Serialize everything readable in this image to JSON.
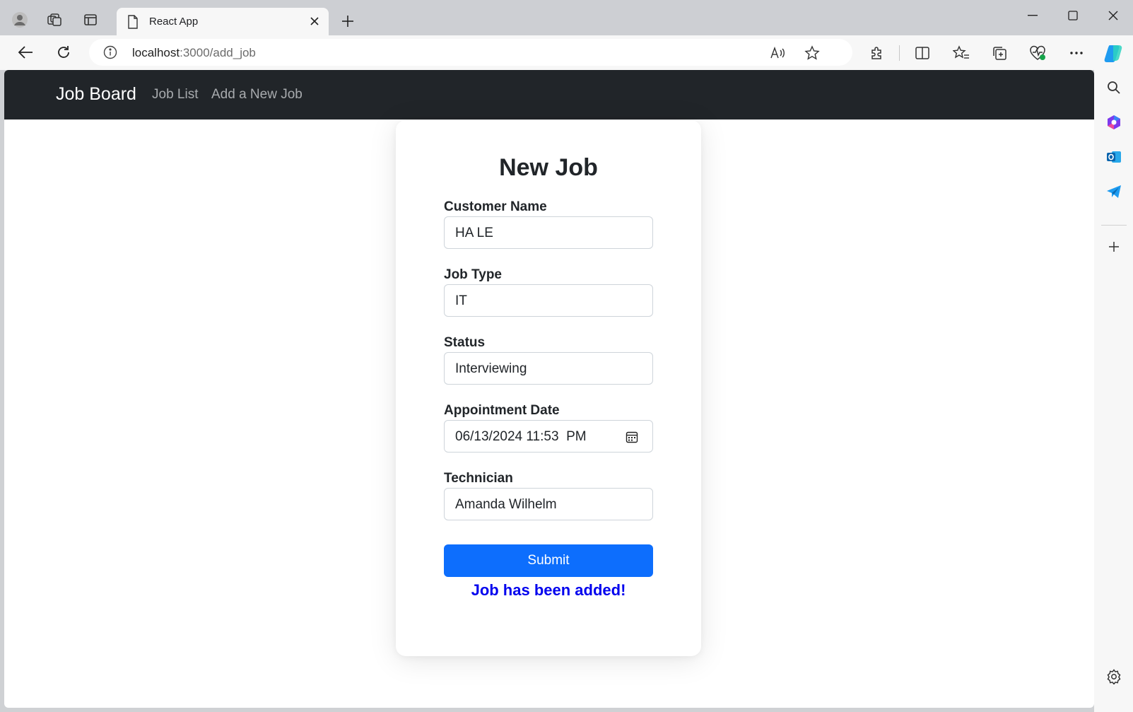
{
  "browser": {
    "tab_title": "React App",
    "address_host": "localhost",
    "address_path": ":3000/add_job"
  },
  "app": {
    "brand": "Job Board",
    "nav_links": [
      "Job List",
      "Add a New Job"
    ]
  },
  "form": {
    "title": "New Job",
    "fields": [
      {
        "label": "Customer Name",
        "value": "HA LE"
      },
      {
        "label": "Job Type",
        "value": "IT"
      },
      {
        "label": "Status",
        "value": "Interviewing"
      },
      {
        "label": "Appointment Date",
        "value": "06/13/2024 11:53  PM"
      },
      {
        "label": "Technician",
        "value": "Amanda Wilhelm"
      }
    ],
    "submit_label": "Submit",
    "success_message": "Job has been added!"
  },
  "colors": {
    "navbar_bg": "#212529",
    "primary": "#0d6efd",
    "success_text": "#0000ee"
  },
  "icons": {
    "tabbar": [
      "profile-icon",
      "workspaces-icon",
      "tab-actions-icon",
      "document-icon",
      "close-icon",
      "new-tab-icon"
    ],
    "toolbar": [
      "back-icon",
      "refresh-icon",
      "info-icon",
      "read-aloud-icon",
      "favorite-star-icon",
      "extensions-icon",
      "split-screen-icon",
      "favorites-icon",
      "collections-icon",
      "browser-essentials-icon",
      "more-icon",
      "copilot-icon"
    ],
    "sidebar": [
      "search-icon",
      "m365-icon",
      "outlook-icon",
      "telegram-icon",
      "add-icon",
      "settings-icon"
    ]
  }
}
